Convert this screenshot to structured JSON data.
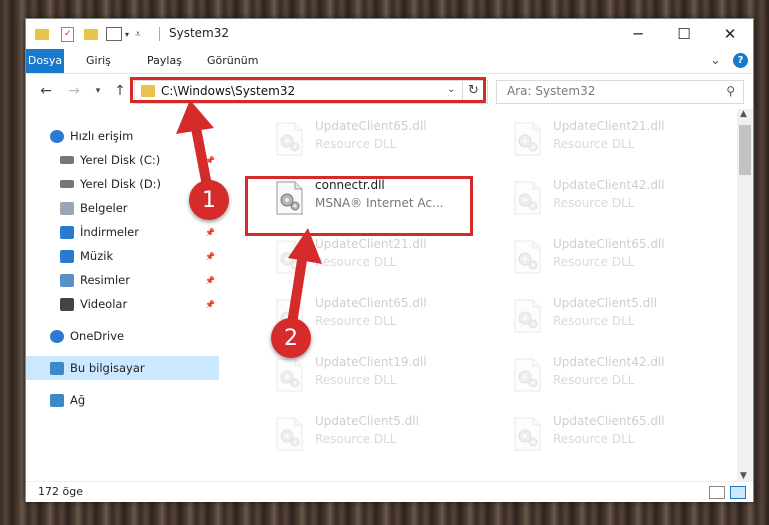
{
  "window": {
    "title": "System32",
    "controls": {
      "minimize": "─",
      "maximize": "☐",
      "close": "✕"
    }
  },
  "ribbon": {
    "tabs": [
      "Dosya",
      "Giriş",
      "Paylaş",
      "Görünüm"
    ],
    "collapse_icon": "⌄",
    "help_icon": "?"
  },
  "nav": {
    "address": "C:\\Windows\\System32",
    "search_placeholder": "Ara: System32"
  },
  "sidebar": {
    "items": [
      {
        "label": "Hızlı erişim",
        "icon": "star-icon",
        "pinned": false
      },
      {
        "label": "Yerel Disk (C:)",
        "icon": "drive-icon",
        "pinned": true
      },
      {
        "label": "Yerel Disk (D:)",
        "icon": "drive-icon",
        "pinned": true
      },
      {
        "label": "Belgeler",
        "icon": "document-icon",
        "pinned": true
      },
      {
        "label": "İndirmeler",
        "icon": "download-icon",
        "pinned": true
      },
      {
        "label": "Müzik",
        "icon": "music-icon",
        "pinned": true
      },
      {
        "label": "Resimler",
        "icon": "pictures-icon",
        "pinned": true
      },
      {
        "label": "Videolar",
        "icon": "video-icon",
        "pinned": true
      },
      {
        "label": "OneDrive",
        "icon": "cloud-icon",
        "pinned": false
      },
      {
        "label": "Bu bilgisayar",
        "icon": "computer-icon",
        "pinned": false,
        "selected": true
      },
      {
        "label": "Ağ",
        "icon": "network-icon",
        "pinned": false
      }
    ]
  },
  "files": {
    "left": [
      {
        "name": "UpdateClient65.dll",
        "desc": "Resource DLL",
        "faded": true
      },
      {
        "name": "connectr.dll",
        "desc": "MSNA® Internet Ac...",
        "faded": false,
        "highlighted": true
      },
      {
        "name": "UpdateClient21.dll",
        "desc": "Resource DLL",
        "faded": true
      },
      {
        "name": "UpdateClient65.dll",
        "desc": "Resource DLL",
        "faded": true
      },
      {
        "name": "UpdateClient19.dll",
        "desc": "Resource DLL",
        "faded": true
      },
      {
        "name": "UpdateClient5.dll",
        "desc": "Resource DLL",
        "faded": true
      }
    ],
    "right": [
      {
        "name": "UpdateClient21.dll",
        "desc": "Resource DLL",
        "faded": true
      },
      {
        "name": "UpdateClient42.dll",
        "desc": "Resource DLL",
        "faded": true
      },
      {
        "name": "UpdateClient65.dll",
        "desc": "Resource DLL",
        "faded": true
      },
      {
        "name": "UpdateClient5.dll",
        "desc": "Resource DLL",
        "faded": true
      },
      {
        "name": "UpdateClient42.dll",
        "desc": "Resource DLL",
        "faded": true
      },
      {
        "name": "UpdateClient65.dll",
        "desc": "Resource DLL",
        "faded": true
      }
    ]
  },
  "status": {
    "count": "172 öge"
  },
  "annotations": {
    "step1": "1",
    "step2": "2",
    "color": "#d52b2b"
  }
}
